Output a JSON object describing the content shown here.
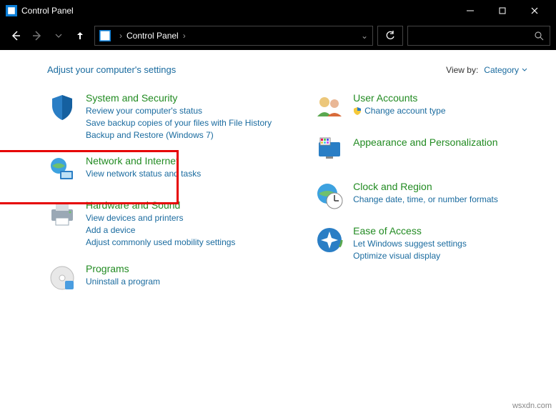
{
  "window": {
    "title": "Control Panel"
  },
  "breadcrumb": {
    "root": "Control Panel"
  },
  "header": {
    "heading": "Adjust your computer's settings",
    "viewby_label": "View by:",
    "viewby_value": "Category"
  },
  "left": [
    {
      "title": "System and Security",
      "links": [
        "Review your computer's status",
        "Save backup copies of your files with File History",
        "Backup and Restore (Windows 7)"
      ]
    },
    {
      "title": "Network and Internet",
      "links": [
        "View network status and tasks"
      ]
    },
    {
      "title": "Hardware and Sound",
      "links": [
        "View devices and printers",
        "Add a device",
        "Adjust commonly used mobility settings"
      ]
    },
    {
      "title": "Programs",
      "links": [
        "Uninstall a program"
      ]
    }
  ],
  "right": [
    {
      "title": "User Accounts",
      "links": [
        "Change account type"
      ],
      "shield": [
        true
      ]
    },
    {
      "title": "Appearance and Personalization",
      "links": []
    },
    {
      "title": "Clock and Region",
      "links": [
        "Change date, time, or number formats"
      ]
    },
    {
      "title": "Ease of Access",
      "links": [
        "Let Windows suggest settings",
        "Optimize visual display"
      ]
    }
  ],
  "highlight": {
    "target": "Network and Internet"
  },
  "watermark": "wsxdn.com"
}
